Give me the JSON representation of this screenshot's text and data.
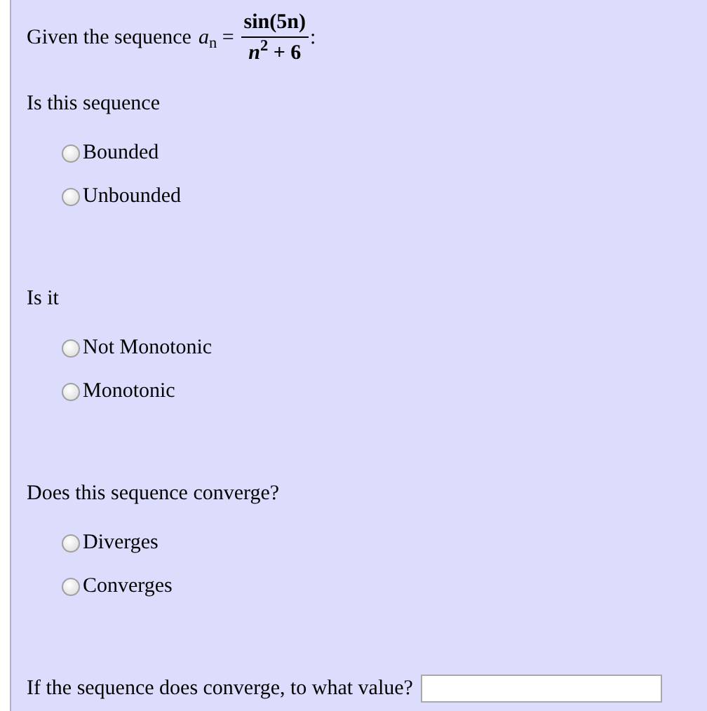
{
  "intro": {
    "text": "Given the sequence",
    "lhs": "*a*$_{n}$ =",
    "numerator": "sin(5n)",
    "denominator": "*n*$^{2}$ + 6",
    "trail": ":"
  },
  "questions": [
    {
      "prompt": "Is this sequence",
      "options": [
        {
          "label": "Bounded",
          "selected": false
        },
        {
          "label": "Unbounded",
          "selected": false
        }
      ]
    },
    {
      "prompt": "Is it",
      "options": [
        {
          "label": "Not Monotonic",
          "selected": false
        },
        {
          "label": "Monotonic",
          "selected": false
        }
      ]
    },
    {
      "prompt": "Does this sequence converge?",
      "options": [
        {
          "label": "Diverges",
          "selected": false
        },
        {
          "label": "Converges",
          "selected": false
        }
      ]
    }
  ],
  "final": {
    "prompt": "If the sequence does converge, to what value?"
  }
}
